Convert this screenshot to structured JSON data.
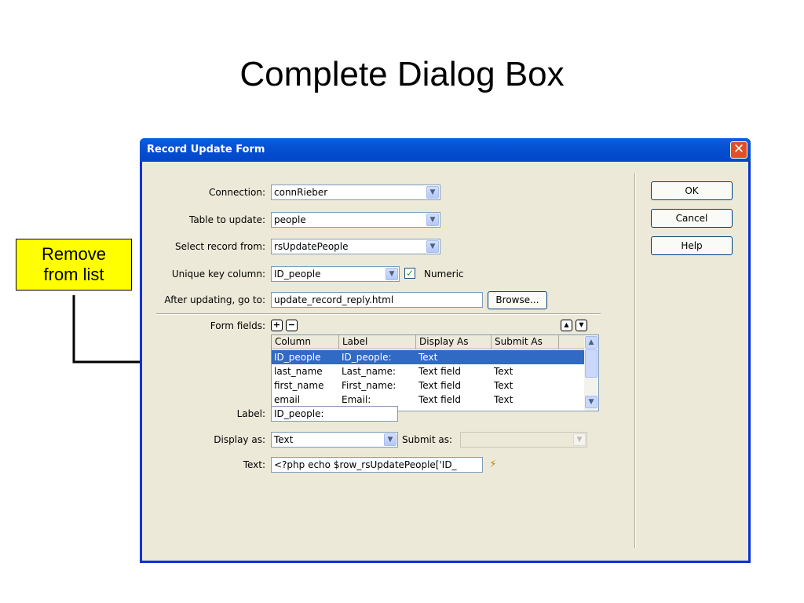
{
  "slide": {
    "title": "Complete Dialog Box",
    "callout": [
      "Remove",
      "from list"
    ]
  },
  "dialog": {
    "title": "Record Update Form",
    "buttons": {
      "ok": "OK",
      "cancel": "Cancel",
      "help": "Help",
      "browse": "Browse..."
    },
    "connection": {
      "label": "Connection:",
      "value": "connRieber"
    },
    "table": {
      "label": "Table to update:",
      "value": "people"
    },
    "select_record": {
      "label": "Select record from:",
      "value": "rsUpdatePeople"
    },
    "unique_key": {
      "label": "Unique key column:",
      "value": "ID_people",
      "numeric_label": "Numeric",
      "numeric_checked": true
    },
    "after_updating": {
      "label": "After updating, go to:",
      "value": "update_record_reply.html"
    },
    "form_fields": {
      "label": "Form fields:",
      "columns": [
        "Column",
        "Label",
        "Display As",
        "Submit As"
      ],
      "rows": [
        [
          "ID_people",
          "ID_people:",
          "Text",
          ""
        ],
        [
          "last_name",
          "Last_name:",
          "Text field",
          "Text"
        ],
        [
          "first_name",
          "First_name:",
          "Text field",
          "Text"
        ],
        [
          "email",
          "Email:",
          "Text field",
          "Text"
        ]
      ],
      "selected_row": 0
    },
    "label_field": {
      "label": "Label:",
      "value": "ID_people:"
    },
    "display_as": {
      "label": "Display as:",
      "value": "Text",
      "submit_label": "Submit as:",
      "submit_value": ""
    },
    "text_field": {
      "label": "Text:",
      "value": "<?php echo $row_rsUpdatePeople['ID_"
    }
  },
  "icons": {
    "close": "close-icon",
    "dropdown": "chevron-down-icon",
    "add": "plus-icon",
    "remove": "minus-icon",
    "up": "arrow-up-icon",
    "down": "arrow-down-icon",
    "dynamic": "lightning-icon"
  },
  "colors": {
    "titlebar": "#0651d3",
    "dialog_bg": "#ece9d8",
    "selection": "#316ac5",
    "callout": "#ffff00",
    "close": "#e24e28"
  }
}
